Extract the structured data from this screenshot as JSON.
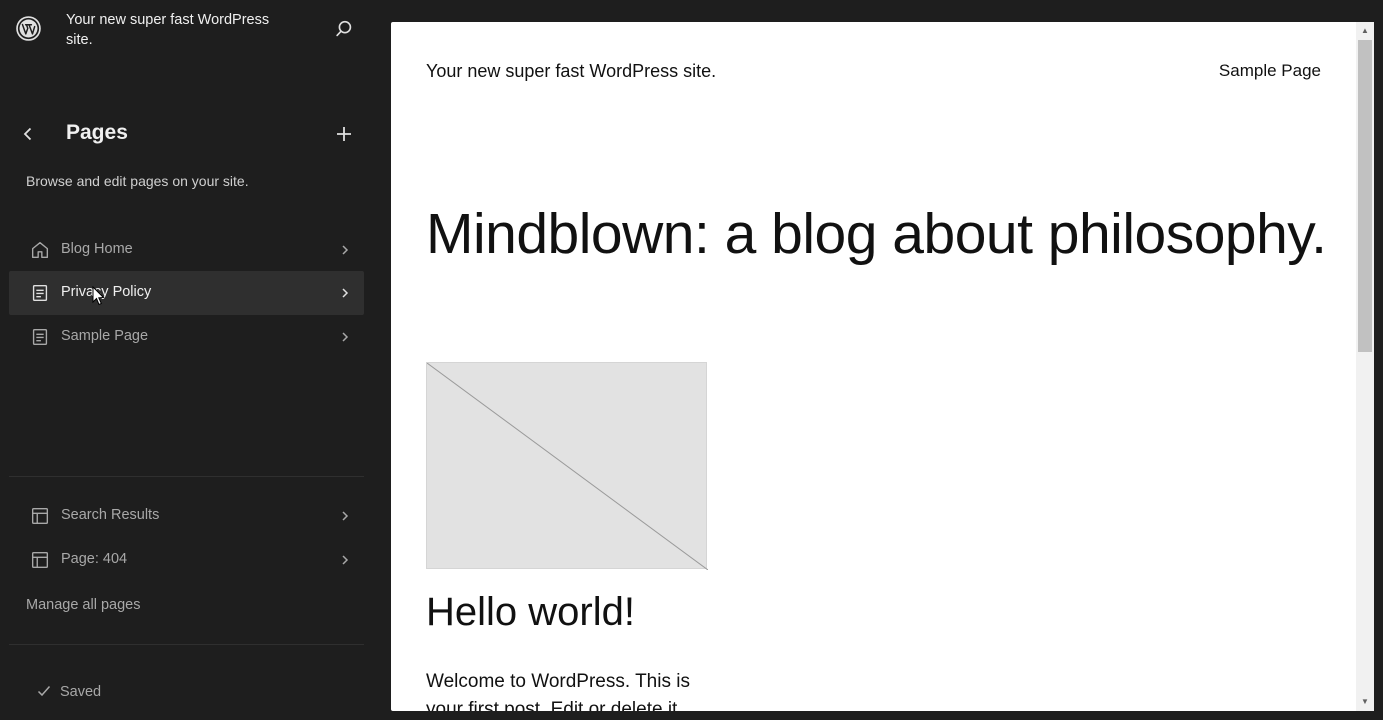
{
  "sidebar": {
    "site_title": "Your new super fast WordPress site.",
    "section_title": "Pages",
    "description": "Browse and edit pages on your site.",
    "pages": [
      {
        "label": "Blog Home",
        "icon": "home-icon"
      },
      {
        "label": "Privacy Policy",
        "icon": "page-icon"
      },
      {
        "label": "Sample Page",
        "icon": "page-icon"
      }
    ],
    "templates": [
      {
        "label": "Search Results",
        "icon": "layout-icon"
      },
      {
        "label": "Page: 404",
        "icon": "layout-icon"
      }
    ],
    "manage_link": "Manage all pages",
    "status": "Saved"
  },
  "preview": {
    "site_title": "Your new super fast WordPress site.",
    "nav_link": "Sample Page",
    "heading": "Mindblown: a blog about philosophy.",
    "post_title": "Hello world!",
    "excerpt": "Welcome to WordPress. This is your first post. Edit or delete it,"
  },
  "colors": {
    "sidebar_bg": "#1e1e1e",
    "active_item_bg": "#2f2f2f",
    "canvas_bg": "#ffffff"
  }
}
